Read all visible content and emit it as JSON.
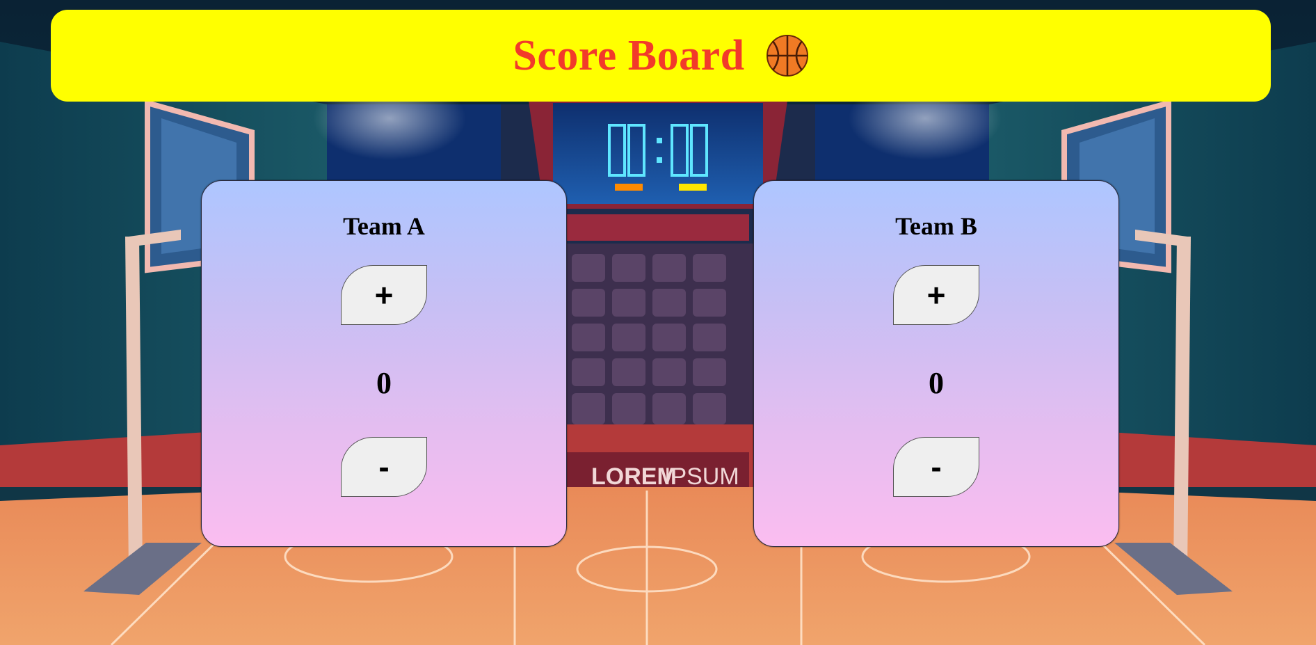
{
  "header": {
    "title": "Score Board",
    "icon": "basketball-icon",
    "background_color": "#ffff00",
    "title_color": "#f23a2a"
  },
  "background": {
    "arena_sign_bold": "LOREM",
    "arena_sign_light": "IPSUM"
  },
  "teams": [
    {
      "name": "Team A",
      "increment_label": "+",
      "score": "0",
      "decrement_label": "-"
    },
    {
      "name": "Team B",
      "increment_label": "+",
      "score": "0",
      "decrement_label": "-"
    }
  ],
  "colors": {
    "card_gradient_top": "#aec6ff",
    "card_gradient_bottom": "#fbbdf0",
    "button_bg": "#efefef"
  }
}
